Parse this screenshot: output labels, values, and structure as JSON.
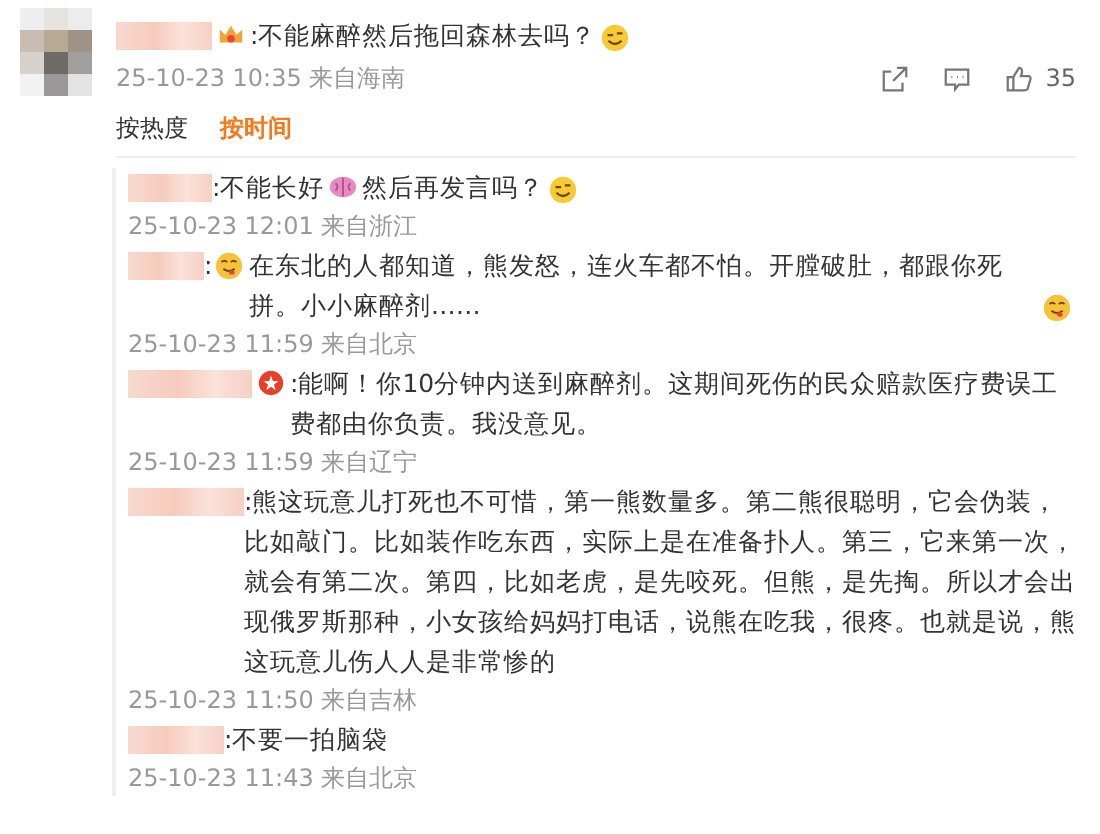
{
  "post": {
    "parts": [
      {
        "kind": "crown"
      },
      {
        "kind": "text",
        "text": ":不能麻醉然后拖回森林去吗？"
      },
      {
        "kind": "grin"
      }
    ],
    "time": "25-10-23 10:35 来自海南",
    "likes": "35"
  },
  "sort_tabs": [
    {
      "label": "按热度",
      "selected": false
    },
    {
      "label": "按时间",
      "selected": true
    }
  ],
  "replies": [
    {
      "parts": [
        {
          "kind": "text",
          "text": ":不能长好"
        },
        {
          "kind": "brain"
        },
        {
          "kind": "text",
          "text": "然后再发言吗？"
        },
        {
          "kind": "grin"
        }
      ],
      "time": "25-10-23 12:01 来自浙江"
    },
    {
      "parts": [
        {
          "kind": "text",
          "text": ":"
        },
        {
          "kind": "yum"
        },
        {
          "kind": "text",
          "text": "在东北的人都知道，熊发怒，连火车都不怕。开膛破肚，都跟你死拼。小小麻醉剂……"
        },
        {
          "kind": "yum"
        }
      ],
      "time": "25-10-23 11:59 来自北京"
    },
    {
      "parts": [
        {
          "kind": "star"
        },
        {
          "kind": "text",
          "text": ":能啊！你10分钟内送到麻醉剂。这期间死伤的民众赔款医疗费误工费都由你负责。我没意见。"
        }
      ],
      "time": "25-10-23 11:59 来自辽宁"
    },
    {
      "parts": [
        {
          "kind": "text",
          "text": ":熊这玩意儿打死也不可惜，第一熊数量多。第二熊很聪明，它会伪装，比如敲门。比如装作吃东西，实际上是在准备扑人。第三，它来第一次，就会有第二次。第四，比如老虎，是先咬死。但熊，是先掏。所以才会出现俄罗斯那种，小女孩给妈妈打电话，说熊在吃我，很疼。也就是说，熊这玩意儿伤人人是非常惨的"
        }
      ],
      "time": "25-10-23 11:50 来自吉林"
    },
    {
      "parts": [
        {
          "kind": "text",
          "text": ":不要一拍脑袋"
        }
      ],
      "time": "25-10-23 11:43 来自北京"
    }
  ]
}
